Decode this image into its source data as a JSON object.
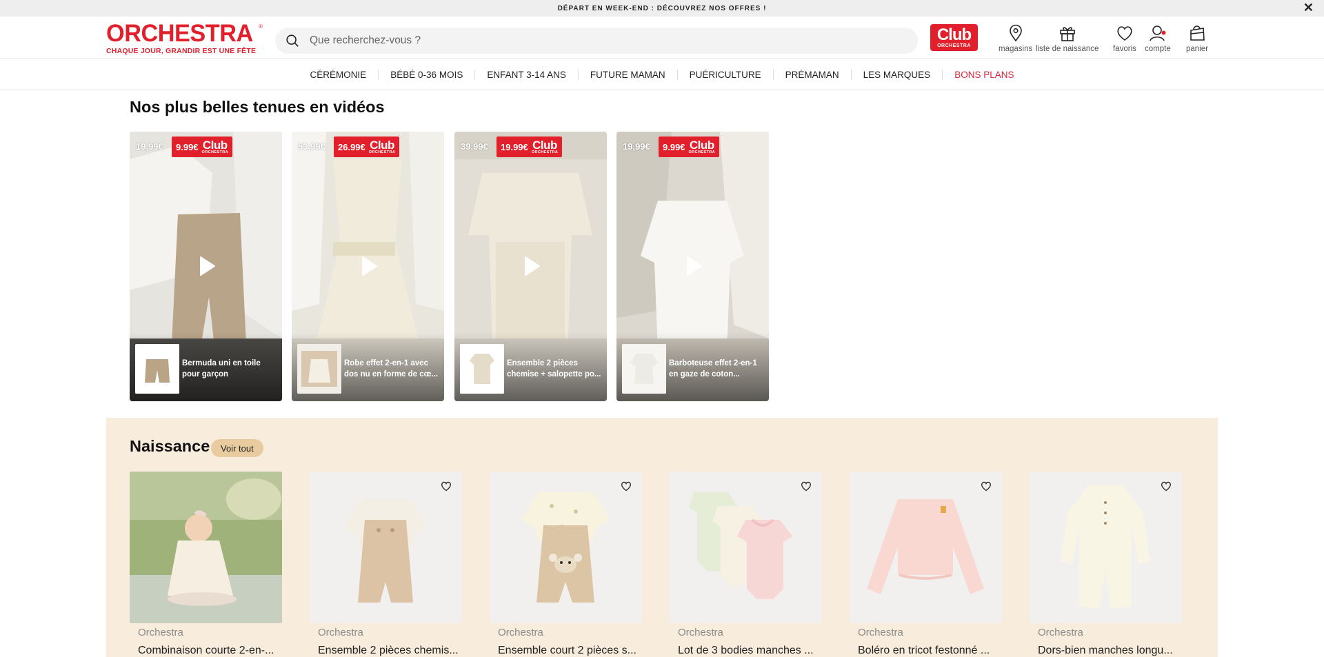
{
  "promo": {
    "text": "DÉPART EN WEEK-END : DÉCOUVREZ NOS OFFRES !"
  },
  "header": {
    "logo_main": "ORCHESTRA",
    "logo_reg": "®",
    "logo_tagline": "CHAQUE JOUR, GRANDIR EST UNE FÊTE",
    "search_placeholder": "Que recherchez-vous ?",
    "club_label": "Club",
    "club_sub": "ORCHESTRA",
    "icons": {
      "stores": "magasins",
      "birth_list": "liste de naissance",
      "favorites": "favoris",
      "account": "compte",
      "cart": "panier"
    }
  },
  "nav": [
    "CÉRÉMONIE",
    "BÉBÉ 0-36 MOIS",
    "ENFANT 3-14 ANS",
    "FUTURE MAMAN",
    "PUÉRICULTURE",
    "PRÉMAMAN",
    "LES MARQUES",
    "BONS PLANS"
  ],
  "videos": {
    "title": "Nos plus belles tenues en vidéos",
    "club_word": "Club",
    "club_sub": "ORCHESTRA",
    "items": [
      {
        "old_price": "19,99€",
        "club_price": "9.99€",
        "product": "Bermuda uni en toile pour garçon"
      },
      {
        "old_price": "53,99€",
        "club_price": "26.99€",
        "product": "Robe effet 2-en-1 avec dos nu en forme de cœ..."
      },
      {
        "old_price": "39,99€",
        "club_price": "19.99€",
        "product": "Ensemble 2 pièces chemise + salopette po..."
      },
      {
        "old_price": "19,99€",
        "club_price": "9.99€",
        "product": "Barboteuse effet 2-en-1 en gaze de coton..."
      }
    ]
  },
  "naissance": {
    "title": "Naissance",
    "see_all": "Voir tout",
    "products": [
      {
        "brand": "Orchestra",
        "name": "Combinaison courte 2-en-..."
      },
      {
        "brand": "Orchestra",
        "name": "Ensemble 2 pièces chemis..."
      },
      {
        "brand": "Orchestra",
        "name": "Ensemble court 2 pièces s..."
      },
      {
        "brand": "Orchestra",
        "name": "Lot de 3 bodies manches ..."
      },
      {
        "brand": "Orchestra",
        "name": "Boléro en tricot festonné ..."
      },
      {
        "brand": "Orchestra",
        "name": "Dors-bien manches longu..."
      }
    ]
  },
  "colors": {
    "brand_red": "#e2202c",
    "sale_nav": "#d5283a",
    "naissance_bg": "#f8ecdd",
    "voir_tout_bg": "#e8cc9f"
  }
}
